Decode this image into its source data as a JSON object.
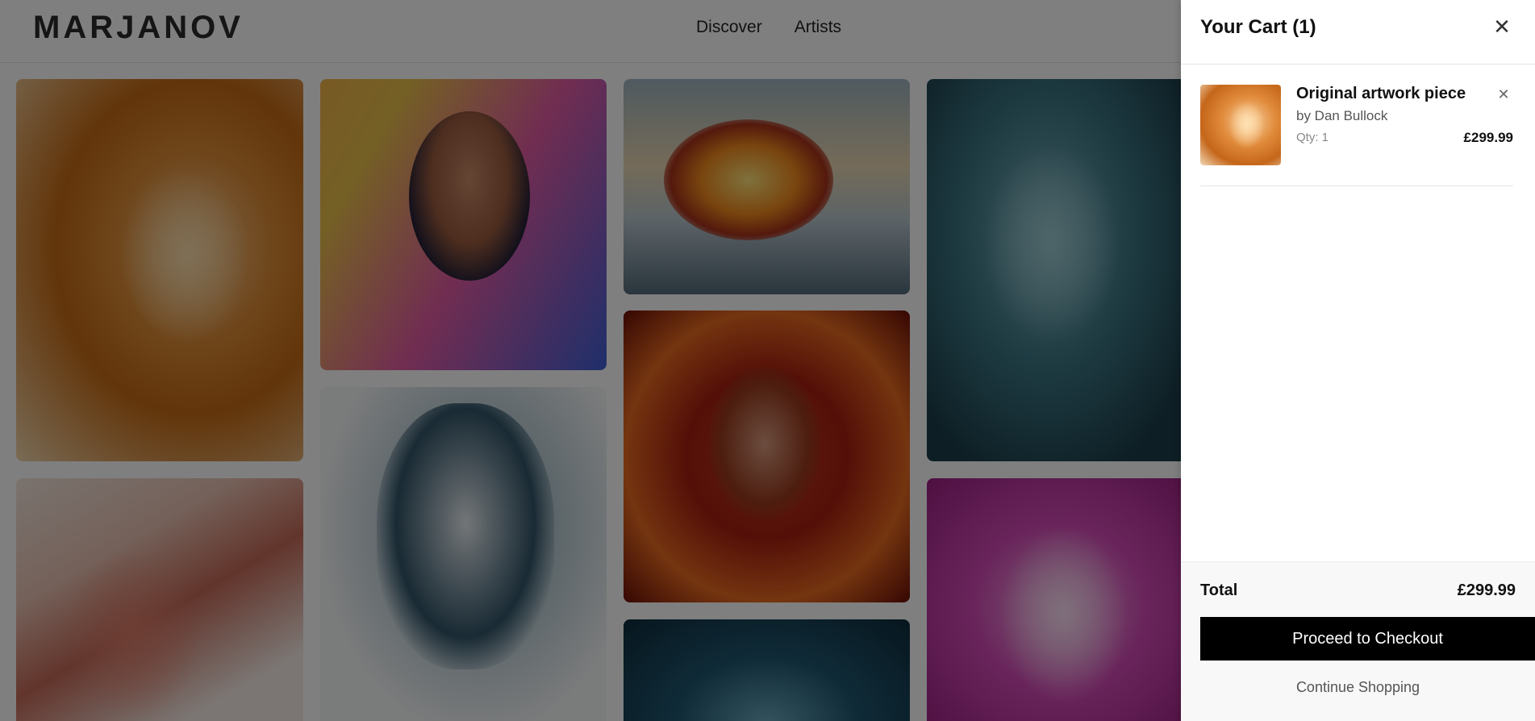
{
  "brand": {
    "logo": "MARJANOV"
  },
  "nav": {
    "discover": "Discover",
    "artists": "Artists"
  },
  "gallery": {
    "items": [
      {
        "name": "amber-portrait"
      },
      {
        "name": "rose-smoke-profile"
      },
      {
        "name": "neon-woman-portrait"
      },
      {
        "name": "ink-smoke-face"
      },
      {
        "name": "fire-smoke-face"
      },
      {
        "name": "red-child-portrait"
      },
      {
        "name": "teal-portrait-partial"
      },
      {
        "name": "teal-sleeping-woman"
      },
      {
        "name": "magenta-floral-figure"
      }
    ]
  },
  "cart": {
    "title": "Your Cart (1)",
    "close_icon": "✕",
    "items": [
      {
        "title": "Original artwork piece",
        "artist": "by Dan Bullock",
        "qty": "Qty: 1",
        "price": "£299.99",
        "remove_icon": "✕"
      }
    ],
    "total_label": "Total",
    "total_value": "£299.99",
    "checkout_label": "Proceed to Checkout",
    "continue_label": "Continue Shopping"
  }
}
